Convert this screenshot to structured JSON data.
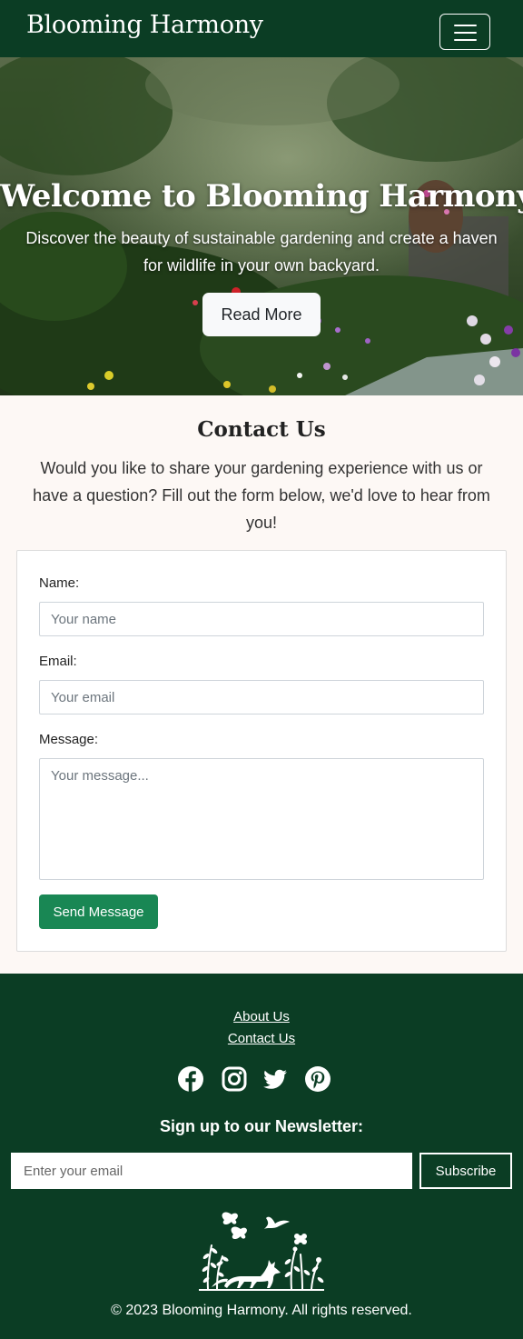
{
  "navbar": {
    "brand": "Blooming Harmony",
    "toggle_icon": "menu-icon"
  },
  "hero": {
    "title": "Welcome to Blooming Harmony",
    "subtitle": "Discover the beauty of sustainable gardening and create a haven for wildlife in your own backyard.",
    "button_label": "Read More"
  },
  "contact": {
    "title": "Contact Us",
    "intro": "Would you like to share your gardening experience with us or have a question? Fill out the form below, we'd love to hear from you!",
    "name_label": "Name:",
    "name_placeholder": "Your name",
    "email_label": "Email:",
    "email_placeholder": "Your email",
    "message_label": "Message:",
    "message_placeholder": "Your message...",
    "submit_label": "Send Message"
  },
  "footer": {
    "links": [
      "About Us",
      "Contact Us"
    ],
    "social_icons": [
      "facebook-icon",
      "instagram-icon",
      "twitter-icon",
      "pinterest-icon"
    ],
    "newsletter_title": "Sign up to our Newsletter:",
    "newsletter_placeholder": "Enter your email",
    "subscribe_label": "Subscribe",
    "copyright": "© 2023 Blooming Harmony. All rights reserved."
  },
  "colors": {
    "brand_green": "#0b3d24",
    "button_green": "#198754",
    "page_background": "#fdf8f5"
  }
}
